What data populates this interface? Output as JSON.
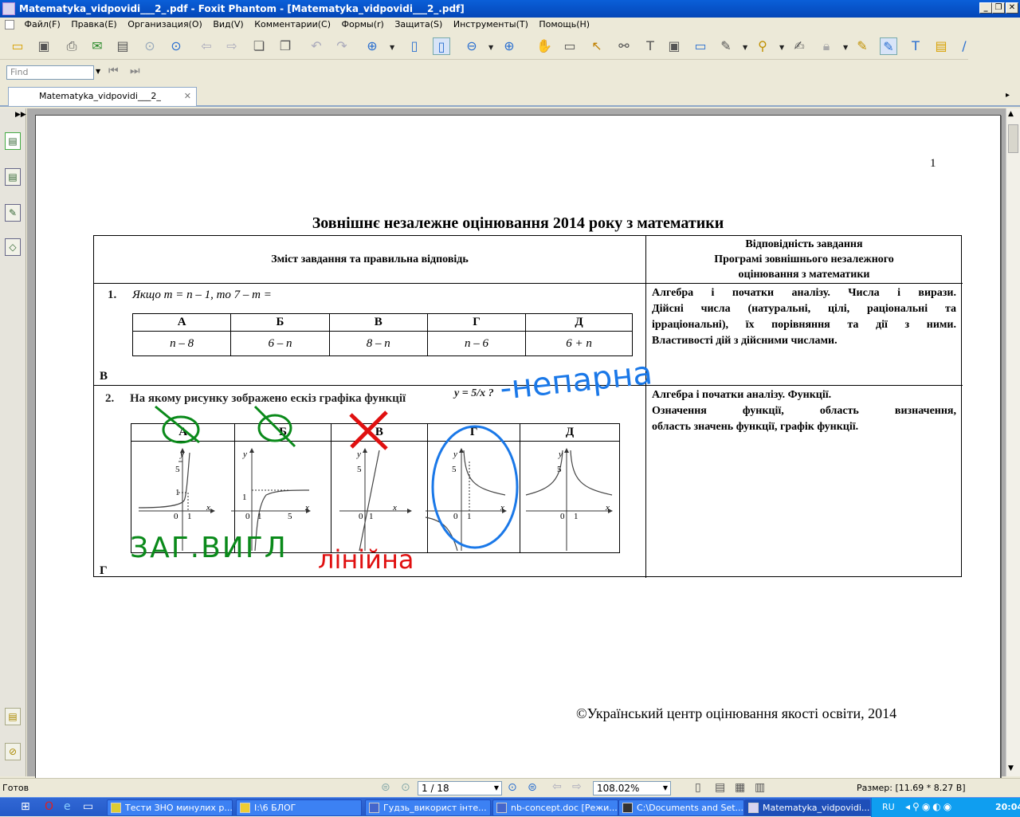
{
  "window": {
    "title": "Matematyka_vidpovidi___2_.pdf - Foxit Phantom - [Matematyka_vidpovidi___2_.pdf]"
  },
  "menu": [
    "Файл(F)",
    "Правка(E)",
    "Организация(O)",
    "Вид(V)",
    "Комментарии(C)",
    "Формы(r)",
    "Защита(S)",
    "Инструменты(T)",
    "Помощь(H)"
  ],
  "find": {
    "placeholder": "Find"
  },
  "tab": {
    "label": "Matematyka_vidpovidi___2_"
  },
  "page": {
    "number": "1",
    "title": "Зовнішнє незалежне оцінювання 2014 року з математики",
    "header_left": "Зміст завдання та правильна  відповідь",
    "header_right": [
      "Відповідність завдання",
      "Програмі  зовнішнього незалежного",
      "оцінювання з математики"
    ],
    "q1": {
      "num": "1.",
      "text": "Якщо m = n – 1,  то  7 – m =",
      "options": [
        "А",
        "Б",
        "В",
        "Г",
        "Д"
      ],
      "values": [
        "n – 8",
        "6 – n",
        "8 – n",
        "n – 6",
        "6 + n"
      ],
      "answer": "В",
      "topic": [
        "Алгебра  і  початки  аналізу.  Числа  і  вирази.",
        "Дійсні  числа  (натуральні,  цілі,  раціональні  та",
        "ірраціональні),  їх  порівняння  та  дії  з  ними.",
        "Властивості дій з дійсними числами."
      ]
    },
    "q2": {
      "num": "2.",
      "text": "На якому рисунку зображено ескіз графіка функції",
      "formula": "y = 5/x ?",
      "options": [
        "А",
        "Б",
        "В",
        "Г",
        "Д"
      ],
      "axis_labels": {
        "y": "y",
        "x": "x",
        "zero": "0",
        "one": "1",
        "five": "5"
      },
      "answer": "Г",
      "topic": [
        "Алгебра і початки аналізу. Функції.",
        "Означення      функції,      область      визначення,",
        "область значень функції, графік функції."
      ]
    },
    "annotations": {
      "blue": "-непарна",
      "green": "ЗАГ.ВИГЛ",
      "red": "лінійна"
    },
    "footer": "©Український центр оцінювання якості освіти, 2014"
  },
  "status": {
    "ready": "Готов",
    "page": "1 / 18",
    "zoom": "108.02%",
    "size": "Размер: [11.69 * 8.27 В]"
  },
  "taskbar": {
    "items": [
      "Тести ЗНО минулих р...",
      "I:\\6 БЛОГ",
      "Гудзь_використ інте...",
      "nb-concept.doc [Режи...",
      "C:\\Documents and Set...",
      "Matematyka_vidpovidi..."
    ],
    "lang": "RU",
    "time": "20:04"
  },
  "colors": {
    "annot_blue": "#1a78e8",
    "annot_green": "#0a8a1a",
    "annot_red": "#e01010"
  }
}
